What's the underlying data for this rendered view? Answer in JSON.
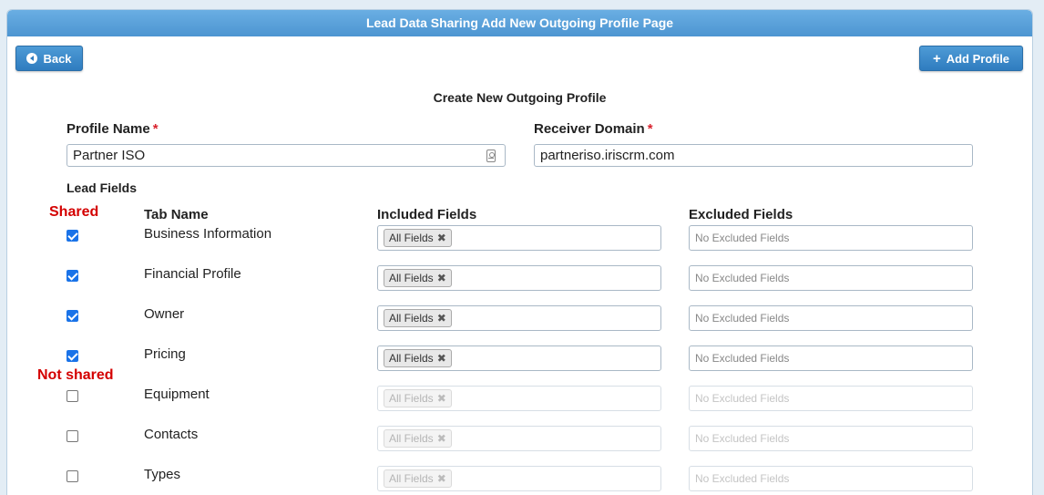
{
  "header": {
    "title": "Lead Data Sharing Add New Outgoing Profile Page"
  },
  "toolbar": {
    "back_label": "Back",
    "add_profile_label": "Add Profile",
    "add_icon": "+"
  },
  "form": {
    "title": "Create New Outgoing Profile",
    "profile_name_label": "Profile Name",
    "profile_name_value": "Partner ISO",
    "receiver_domain_label": "Receiver Domain",
    "receiver_domain_value": "partneriso.iriscrm.com",
    "required_mark": "*",
    "lead_fields_label": "Lead Fields"
  },
  "annotations": {
    "shared": "Shared",
    "not_shared": "Not shared"
  },
  "columns": {
    "tab_name": "Tab Name",
    "included": "Included Fields",
    "excluded": "Excluded Fields"
  },
  "rows": [
    {
      "tab": "Business Information",
      "checked": true,
      "included_tag": "All Fields",
      "excluded_placeholder": "No Excluded Fields"
    },
    {
      "tab": "Financial Profile",
      "checked": true,
      "included_tag": "All Fields",
      "excluded_placeholder": "No Excluded Fields"
    },
    {
      "tab": "Owner",
      "checked": true,
      "included_tag": "All Fields",
      "excluded_placeholder": "No Excluded Fields"
    },
    {
      "tab": "Pricing",
      "checked": true,
      "included_tag": "All Fields",
      "excluded_placeholder": "No Excluded Fields"
    },
    {
      "tab": "Equipment",
      "checked": false,
      "included_tag": "All Fields",
      "excluded_placeholder": "No Excluded Fields"
    },
    {
      "tab": "Contacts",
      "checked": false,
      "included_tag": "All Fields",
      "excluded_placeholder": "No Excluded Fields"
    },
    {
      "tab": "Types",
      "checked": false,
      "included_tag": "All Fields",
      "excluded_placeholder": "No Excluded Fields"
    }
  ],
  "colors": {
    "header": "#5aa3dc",
    "button": "#3a88c9",
    "annotation": "#d40000",
    "checkbox": "#1a73e8"
  },
  "tag_remove_glyph": "✖"
}
